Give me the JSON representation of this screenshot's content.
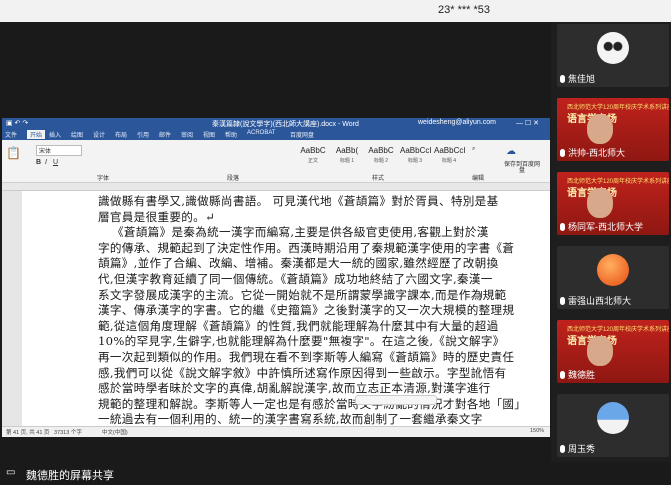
{
  "top_bar": {
    "title": "23* *** *53"
  },
  "word": {
    "title": "秦漢篇隸(說文學字)(西北師大講座).docx - Word",
    "user": "weidesheng@aliyun.com",
    "tabs": [
      "文件",
      "开始",
      "插入",
      "绘图",
      "设计",
      "布局",
      "引用",
      "邮件",
      "审阅",
      "视图",
      "帮助",
      "ACROBAT",
      "百度网盘"
    ],
    "font_name": "宋体",
    "styles": [
      {
        "sample": "AaBbC",
        "name": "正文"
      },
      {
        "sample": "AaBb(",
        "name": "标题 1"
      },
      {
        "sample": "AaBbC",
        "name": "标题 2"
      },
      {
        "sample": "AaBbCcI",
        "name": "标题 3"
      },
      {
        "sample": "AaBbCcI",
        "name": "标题 4"
      }
    ],
    "ribbon_groups": {
      "font": "字体",
      "paragraph": "段落",
      "styles": "样式",
      "edit": "编辑",
      "save": "保存到百度网盘"
    },
    "doc_lines": [
      "識做縣有書學又,識做縣尚書語。 可見漢代地《蒼頡篇》對於胥員、特別是基",
      "層官員是很重要的。↵",
      "《蒼頡篇》是秦為統一漢字而編寫,主要是供各級官吏使用,客觀上對於漢",
      "字的傳承、規範起到了決定性作用。西漢時期沿用了秦規範漢字使用的字書《蒼",
      "頡篇》,並作了合編、改編、增補。秦漢都是大一統的國家,雖然經歷了改朝換",
      "代,但漢字教育延續了同一個傳統。《蒼頡篇》成功地終結了六國文字,秦漢一",
      "系文字發展成漢字的主流。它從一開始就不是所謂蒙學識字課本,而是作為規範",
      "漢字、傳承漢字的字書。它的繼《史籀篇》之後對漢字的又一次大規模的整理規",
      "範,從這個角度理解《蒼頡篇》的性質,我們就能理解為什麼其中有大量的超過",
      "10%的罕見字,生僻字,也就能理解為什麼要\"無複字\"。在這之後,《說文解字》",
      "再一次起到類似的作用。我們現在看不到李斯等人編寫《蒼頡篇》時的歷史責任",
      "感,我們可以從《說文解字敘》中許慎所述寫作原因得到一些啟示。字型訛悟有",
      "感於當時學者昧於文字的真偉,胡亂解說漢字,故而立志正本清源,對漢字進行",
      "規範的整理和解說。李斯等人一定也是有感於當時文字紛亂的情況才對各地「國」",
      "一統過去有一個利用的、統一的漢字書寫系統,故而創制了一套繼承秦文字"
    ],
    "status": {
      "page": "第 41 页, 共 41 页",
      "words": "37313 个字",
      "lang": "中文(中国)",
      "zoom": "150%"
    }
  },
  "participants": [
    {
      "name": "焦佳旭",
      "type": "avatar-panda"
    },
    {
      "name": "洪帅-西北师大",
      "type": "video-banner"
    },
    {
      "name": "杨同军-西北师大学",
      "type": "video-banner"
    },
    {
      "name": "雷强山西北师大",
      "type": "avatar-orange"
    },
    {
      "name": "魏德胜",
      "type": "video-banner"
    },
    {
      "name": "周玉秀",
      "type": "avatar-sky"
    }
  ],
  "banner_text": {
    "line1": "西北师范大学120周年校庆学术系列讲座",
    "line2": "语言学专场"
  },
  "bottom_bar": {
    "share_label": "魏德胜的屏幕共享"
  },
  "colors": {
    "word_blue": "#2b579a",
    "banner_red": "#c0221c",
    "dark_bg": "#1a1a1a"
  }
}
